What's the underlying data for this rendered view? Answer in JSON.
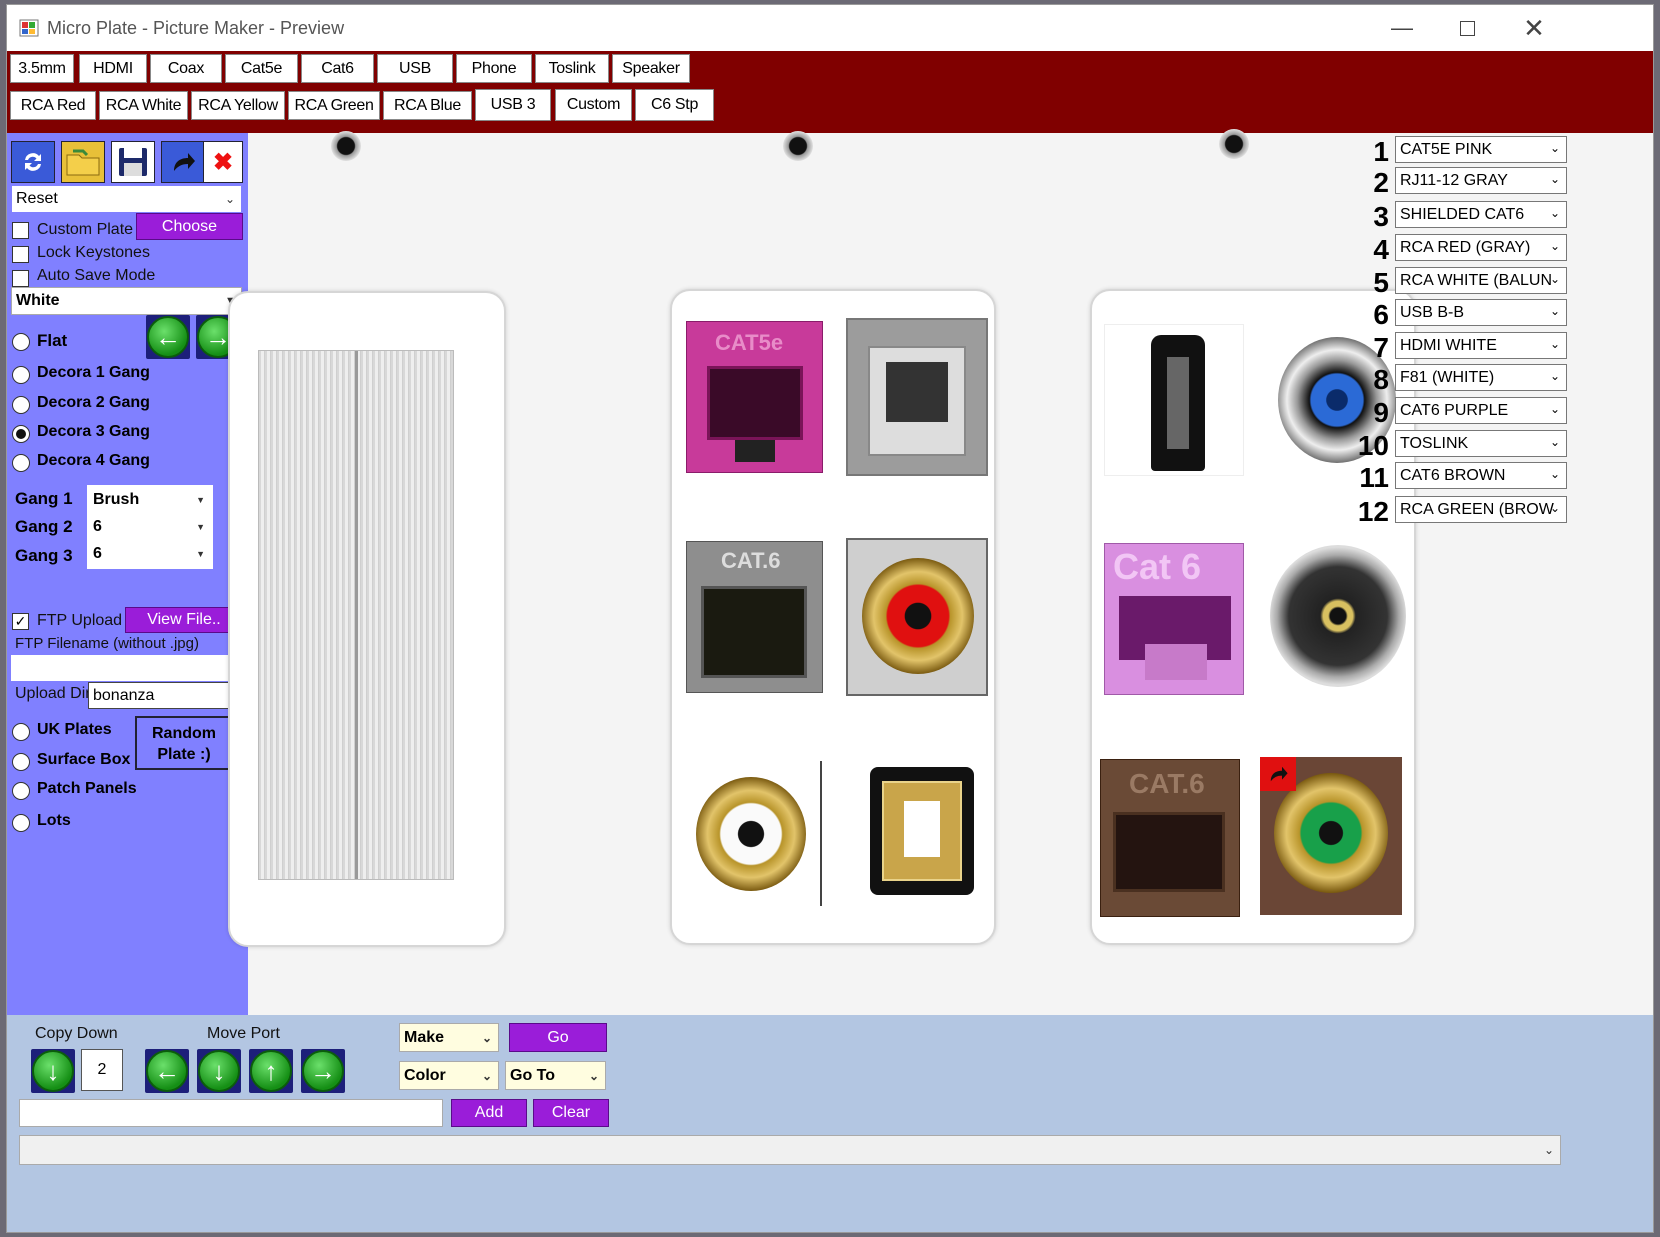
{
  "window": {
    "title": "Micro Plate - Picture Maker - Preview",
    "minimize_icon": "minimize-icon",
    "maximize_icon": "maximize-icon",
    "close_icon": "close-icon"
  },
  "toolbar": {
    "row1": [
      "3.5mm",
      "HDMI",
      "Coax",
      "Cat5e",
      "Cat6",
      "USB",
      "Phone",
      "Toslink",
      "Speaker"
    ],
    "row2": [
      "RCA Red",
      "RCA White",
      "RCA Yellow",
      "RCA Green",
      "RCA Blue",
      "USB 3",
      "Custom",
      "C6 Stp"
    ]
  },
  "sidebar": {
    "preset": "Reset",
    "custom_plate": "Custom Plate",
    "choose": "Choose",
    "lock_keystones": "Lock Keystones",
    "auto_save": "Auto Save Mode",
    "color": "White",
    "flat": "Flat",
    "styles": [
      "Decora 1 Gang",
      "Decora 2 Gang",
      "Decora 3 Gang",
      "Decora 4 Gang"
    ],
    "gang_labels": [
      "Gang 1",
      "Gang 2",
      "Gang 3"
    ],
    "gang_values": [
      "Brush",
      "6",
      "6"
    ],
    "ftp_upload": "FTP Upload",
    "view_file": "View File..",
    "ftp_filename_label": "FTP Filename (without .jpg)",
    "ftp_filename": "",
    "upload_dir_label": "Upload Dir",
    "upload_dir": "bonanza",
    "uk_plates": "UK Plates",
    "surface_box": "Surface Box",
    "patch_panels": "Patch Panels",
    "lots": "Lots",
    "random_plate": "Random Plate :)"
  },
  "canvas": {
    "jack_labels": {
      "cat5e": "CAT5e",
      "cat6a": "CAT.6",
      "cat6b": "Cat 6",
      "cat6c": "CAT.6"
    },
    "ports": [
      {
        "num": "1",
        "value": "CAT5E PINK"
      },
      {
        "num": "2",
        "value": "RJ11-12 GRAY"
      },
      {
        "num": "3",
        "value": "SHIELDED CAT6"
      },
      {
        "num": "4",
        "value": "RCA RED (GRAY)"
      },
      {
        "num": "5",
        "value": "RCA WHITE (BALUN"
      },
      {
        "num": "6",
        "value": "USB B-B"
      },
      {
        "num": "7",
        "value": "HDMI WHITE"
      },
      {
        "num": "8",
        "value": "F81 (WHITE)"
      },
      {
        "num": "9",
        "value": "CAT6 PURPLE"
      },
      {
        "num": "10",
        "value": "TOSLINK"
      },
      {
        "num": "11",
        "value": "CAT6 BROWN"
      },
      {
        "num": "12",
        "value": "RCA GREEN (BROW"
      }
    ]
  },
  "bottom": {
    "copy_down": "Copy Down",
    "copy_count": "2",
    "move_port": "Move Port",
    "make": "Make",
    "color": "Color",
    "go": "Go",
    "go_to": "Go To",
    "add": "Add",
    "clear": "Clear",
    "text_input": "",
    "status_select": ""
  },
  "colors": {
    "toolbar_band": "#800000",
    "sidebar": "#8080ff",
    "purple_button": "#9a1dd9",
    "bottom_panel": "#b3c6e2"
  }
}
